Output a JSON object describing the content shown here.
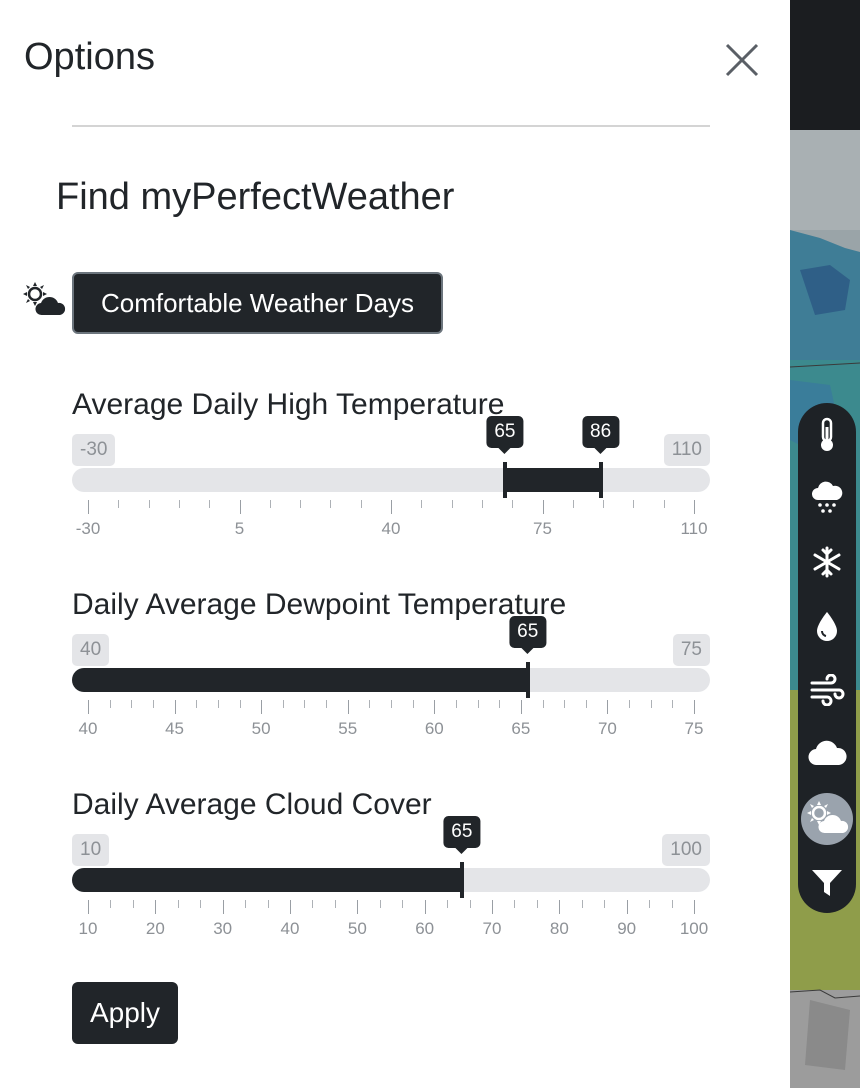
{
  "panel": {
    "title": "Options",
    "heading": "Find myPerfectWeather",
    "preset_button": "Comfortable Weather Days",
    "apply_label": "Apply"
  },
  "sliders": [
    {
      "label": "Average Daily High Temperature",
      "min_label": "-30",
      "max_label": "110",
      "min": -30,
      "max": 110,
      "selected_low": 65,
      "selected_high": 86,
      "low_label": "65",
      "high_label": "86",
      "range": true,
      "tick_labels": [
        "-30",
        "5",
        "40",
        "75",
        "110"
      ],
      "minor_ticks": 20
    },
    {
      "label": "Daily Average Dewpoint Temperature",
      "min_label": "40",
      "max_label": "75",
      "min": 40,
      "max": 75,
      "selected_high": 65,
      "high_label": "65",
      "range": false,
      "tick_labels": [
        "40",
        "45",
        "50",
        "55",
        "60",
        "65",
        "70",
        "75"
      ],
      "minor_ticks": 28
    },
    {
      "label": "Daily Average Cloud Cover",
      "min_label": "10",
      "max_label": "100",
      "min": 10,
      "max": 100,
      "selected_high": 65,
      "high_label": "65",
      "range": false,
      "tick_labels": [
        "10",
        "20",
        "30",
        "40",
        "50",
        "60",
        "70",
        "80",
        "90",
        "100"
      ],
      "minor_ticks": 27
    }
  ],
  "toolbar": {
    "items": [
      {
        "icon": "thermometer-icon",
        "active": false
      },
      {
        "icon": "rain-icon",
        "active": false
      },
      {
        "icon": "snowflake-icon",
        "active": false
      },
      {
        "icon": "humidity-drop-icon",
        "active": false
      },
      {
        "icon": "wind-icon",
        "active": false
      },
      {
        "icon": "cloud-icon",
        "active": false
      },
      {
        "icon": "sun-cloud-icon",
        "active": true
      },
      {
        "icon": "filter-icon",
        "active": false
      }
    ]
  },
  "colors": {
    "dark": "#212529",
    "track": "#e4e5e8",
    "muted_text": "#8d9196",
    "toolbar_bg": "#1e2226",
    "toolbar_active": "#9aa3ad"
  }
}
